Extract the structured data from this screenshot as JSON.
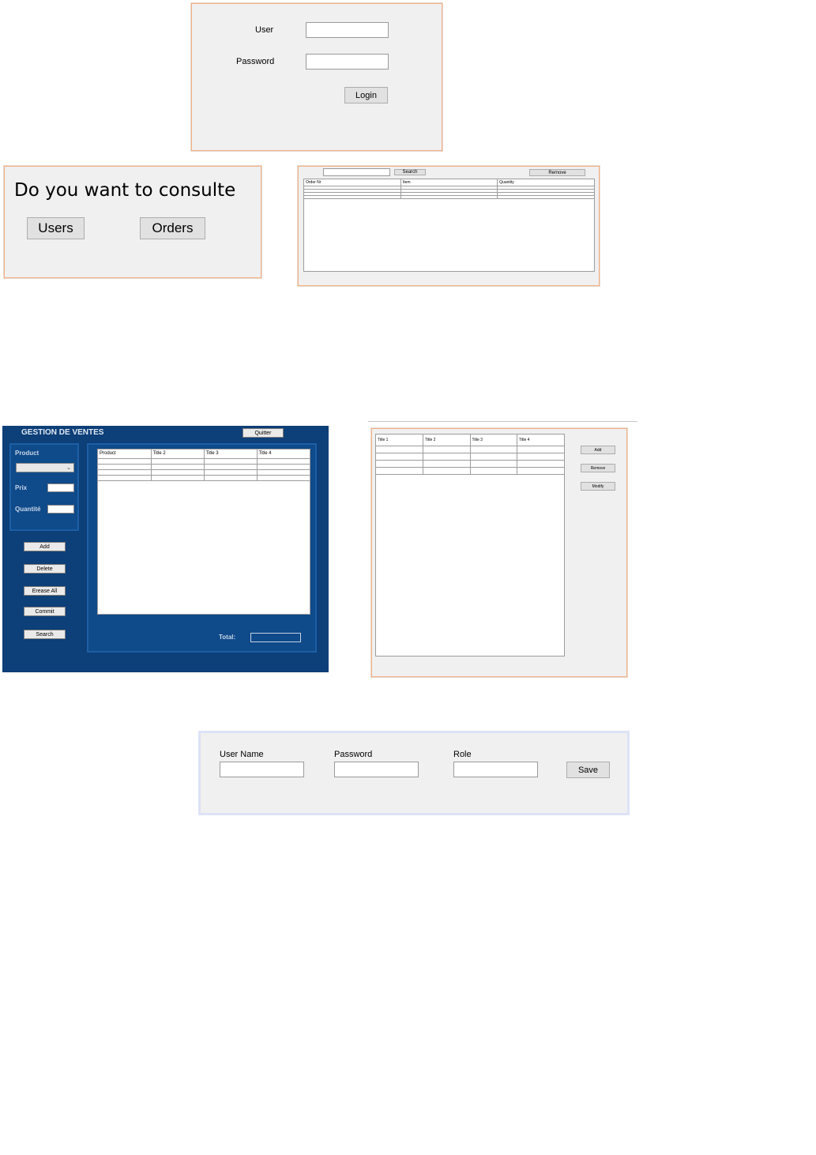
{
  "login": {
    "user_label": "User",
    "password_label": "Password",
    "login_button": "Login"
  },
  "consult": {
    "question": "Do you want to consulte",
    "users_button": "Users",
    "orders_button": "Orders"
  },
  "orders_window": {
    "search_button": "Search",
    "remove_button": "Remove",
    "columns": [
      "Order Nr",
      "Item",
      "Quantity"
    ]
  },
  "sales_app": {
    "title": "GESTION DE VENTES",
    "quit_button": "Quitter",
    "product_label": "Product",
    "price_label": "Prix",
    "quantity_label": "Quantité",
    "buttons": [
      "Add",
      "Delete",
      "Erease All",
      "Commit",
      "Search"
    ],
    "columns": [
      "Product",
      "Title 2",
      "Title 3",
      "Title 4"
    ],
    "total_label": "Total:"
  },
  "table_window": {
    "columns": [
      "Title 1",
      "Title 2",
      "Title 3",
      "Title 4"
    ],
    "buttons": [
      "Add",
      "Remove",
      "Modify"
    ]
  },
  "user_form": {
    "username_label": "User Name",
    "password_label": "Password",
    "role_label": "Role",
    "save_button": "Save"
  }
}
